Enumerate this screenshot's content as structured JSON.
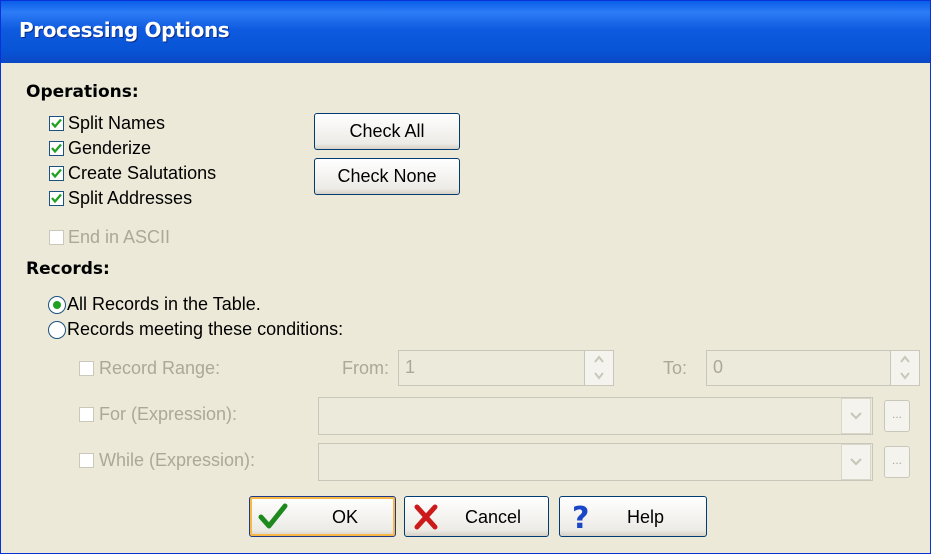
{
  "window": {
    "title": "Processing Options"
  },
  "operations": {
    "header": "Operations:",
    "items": [
      {
        "label": "Split Names",
        "checked": true
      },
      {
        "label": "Genderize",
        "checked": true
      },
      {
        "label": "Create Salutations",
        "checked": true
      },
      {
        "label": "Split Addresses",
        "checked": true
      }
    ],
    "end_ascii": {
      "label": "End in ASCII",
      "checked": false,
      "disabled": true
    },
    "check_all_label": "Check All",
    "check_none_label": "Check None"
  },
  "records": {
    "header": "Records:",
    "options": [
      {
        "label": "All Records in the Table.",
        "selected": true
      },
      {
        "label": "Records meeting these conditions:",
        "selected": false
      }
    ],
    "record_range": {
      "label": "Record Range:",
      "from_label": "From:",
      "from_value": "1",
      "to_label": "To:",
      "to_value": "0"
    },
    "for_expression": {
      "label": "For (Expression):",
      "value": ""
    },
    "while_expression": {
      "label": "While (Expression):",
      "value": ""
    }
  },
  "buttons": {
    "ok": "OK",
    "cancel": "Cancel",
    "help": "Help"
  },
  "colors": {
    "titlebar": "#0a5fe8",
    "face": "#ece9d8",
    "check": "#21a121",
    "disabled_text": "#aca899"
  },
  "icons": {
    "ok": "green-checkmark-icon",
    "cancel": "red-x-icon",
    "help": "blue-question-icon"
  }
}
